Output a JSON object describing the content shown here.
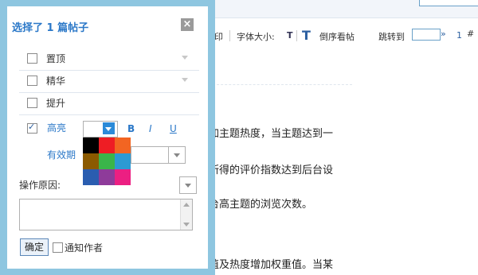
{
  "background": {
    "toolbar": {
      "print_fragment": "印",
      "font_size_label": "字体大小:",
      "font_size_icon": "T",
      "sort_icon": "T",
      "reverse_order_label": "倒序看帖",
      "jump_label": "跳转到",
      "jump_arrow": "»",
      "floor_number": "1",
      "floor_unit": "#"
    },
    "content_lines": [
      "。",
      "加主题热度，当主题达到一",
      "所得的评价指数达到后台设",
      "台高主题的浏览次数。",
      "值及热度增加权重值。当某"
    ]
  },
  "dialog": {
    "title": "选择了  1 篇帖子",
    "close_label": "×",
    "options": [
      {
        "label": "置顶",
        "checked": false
      },
      {
        "label": "精华",
        "checked": false
      },
      {
        "label": "提升",
        "checked": false
      }
    ],
    "highlight": {
      "label": "高亮",
      "checked": true,
      "bold_label": "B",
      "italic_label": "I",
      "underline_label": "U",
      "palette_colors": [
        "#000000",
        "#ee1d24",
        "#f26522",
        "#8b5a00",
        "#3ab54a",
        "#2d9ad3",
        "#2a5db0",
        "#8e3b9a",
        "#ec1f82"
      ]
    },
    "valid_period_label": "有效期",
    "reason_label": "操作原因:",
    "confirm_label": "确定",
    "notify_label": "通知作者",
    "notify_checked": false
  }
}
